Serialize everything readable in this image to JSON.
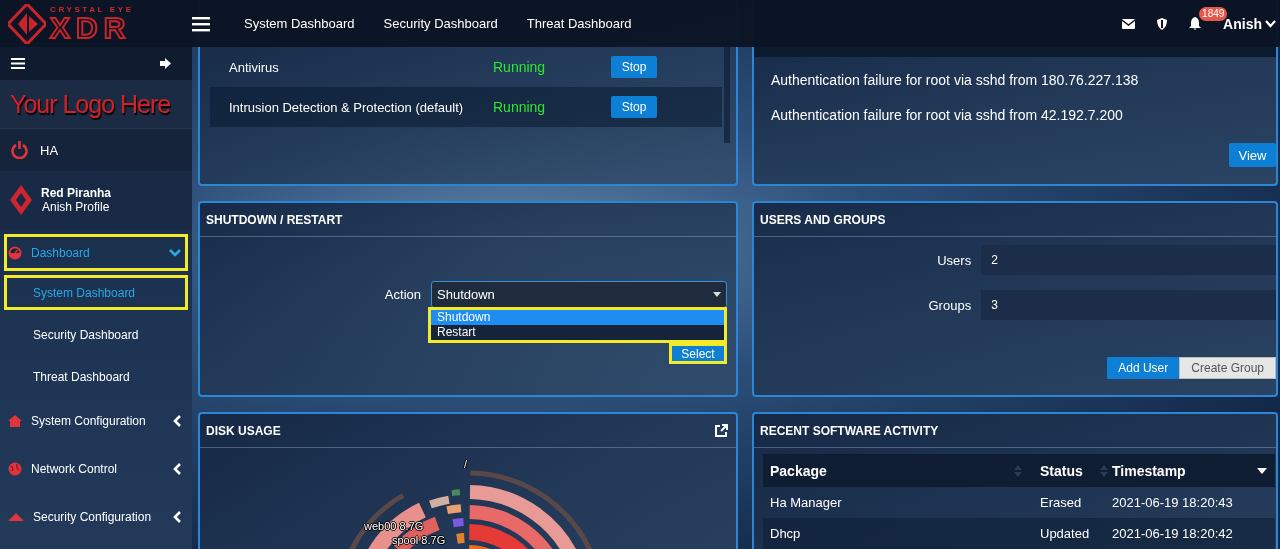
{
  "topbar": {
    "brand_small": "CRYSTAL EYE",
    "brand_large": "XDR",
    "nav": [
      {
        "label": "System Dashboard"
      },
      {
        "label": "Security Dashboard"
      },
      {
        "label": "Threat Dashboard"
      }
    ],
    "notification_count": "1849",
    "user": "Anish"
  },
  "sidebar": {
    "logo_text": "Your Logo Here",
    "ha": "HA",
    "profile": {
      "name": "Red Piranha",
      "subtitle": "Anish Profile"
    },
    "items": [
      {
        "label": "Dashboard",
        "expanded": true,
        "selected": true,
        "highlighted": true,
        "children": [
          {
            "label": "System Dashboard",
            "selected": true,
            "highlighted": true
          },
          {
            "label": "Security Dashboard",
            "selected": false,
            "highlighted": false
          },
          {
            "label": "Threat Dashboard",
            "selected": false,
            "highlighted": false
          }
        ]
      },
      {
        "label": "System Configuration",
        "expanded": false,
        "selected": false,
        "highlighted": false
      },
      {
        "label": "Network Control",
        "expanded": false,
        "selected": false,
        "highlighted": false
      },
      {
        "label": "Security Configuration",
        "expanded": false,
        "selected": false,
        "highlighted": false
      }
    ]
  },
  "services": {
    "rows": [
      {
        "name": "Antivirus",
        "status": "Running",
        "action": "Stop"
      },
      {
        "name": "Intrusion Detection & Protection (default)",
        "status": "Running",
        "action": "Stop"
      }
    ]
  },
  "notifications": {
    "items": [
      "Authentication failure for root via sshd from 180.76.227.138",
      "Authentication failure for root via sshd from 42.192.7.200"
    ],
    "button": "View"
  },
  "shutdown": {
    "title": "SHUTDOWN / RESTART",
    "action_label": "Action",
    "value": "Shutdown",
    "options_highlighted": true,
    "options": [
      {
        "label": "Shutdown",
        "selected": true
      },
      {
        "label": "Restart",
        "selected": false
      }
    ],
    "button": "Select",
    "button_highlighted": true
  },
  "users_groups": {
    "title": "USERS AND GROUPS",
    "fields": [
      {
        "label": "Users",
        "value": "2"
      },
      {
        "label": "Groups",
        "value": "3"
      }
    ],
    "buttons": [
      {
        "label": "Add User",
        "kind": "primary"
      },
      {
        "label": "Create Group",
        "kind": "default"
      }
    ]
  },
  "disk_usage": {
    "title": "DISK USAGE",
    "labels": [
      "/",
      "web00 8.7G",
      "spool 8.7G"
    ]
  },
  "software": {
    "title": "RECENT SOFTWARE ACTIVITY",
    "columns": [
      {
        "label": "Package",
        "sorted": false
      },
      {
        "label": "Status",
        "sorted": false
      },
      {
        "label": "Timestamp",
        "sorted": true
      }
    ],
    "rows": [
      [
        "Ha Manager",
        "Erased",
        "2021-06-19 18:20:43"
      ],
      [
        "Dhcp",
        "Updated",
        "2021-06-19 18:20:42"
      ]
    ]
  }
}
